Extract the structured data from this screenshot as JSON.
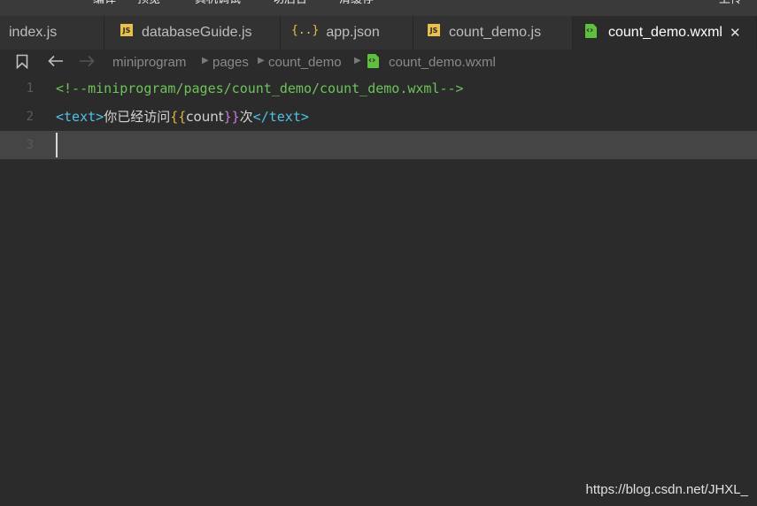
{
  "toolbar": {
    "items": [
      "编译",
      "预览",
      "真机调试",
      "切后台",
      "清缓存",
      "上传"
    ]
  },
  "tabs": [
    {
      "label": "index.js",
      "icon": "js-icon"
    },
    {
      "label": "databaseGuide.js",
      "icon": "js-icon"
    },
    {
      "label": "app.json",
      "icon": "json-icon"
    },
    {
      "label": "count_demo.js",
      "icon": "js-icon"
    },
    {
      "label": "count_demo.wxml",
      "icon": "wxml-icon",
      "active": true,
      "close": "✕"
    }
  ],
  "breadcrumb": {
    "segments": [
      "miniprogram",
      "pages",
      "count_demo",
      "count_demo.wxml"
    ]
  },
  "editor": {
    "lines": [
      {
        "number": "1",
        "comment": "<!--miniprogram/pages/count_demo/count_demo.wxml-->"
      },
      {
        "number": "2",
        "open_tag": "<text>",
        "text": "你已经访问",
        "brace_open": "{{",
        "var": "count",
        "brace_close": "}}",
        "text2": "次",
        "close_tag": "</text>"
      },
      {
        "number": "3"
      }
    ]
  },
  "watermark": "https://blog.csdn.net/JHXL_",
  "colors": {
    "background": "#2b2b2b",
    "comment": "#6cc35a",
    "tag": "#4fc1e9",
    "js_icon": "#e8c04a",
    "wxml_icon": "#5fbf3f"
  }
}
